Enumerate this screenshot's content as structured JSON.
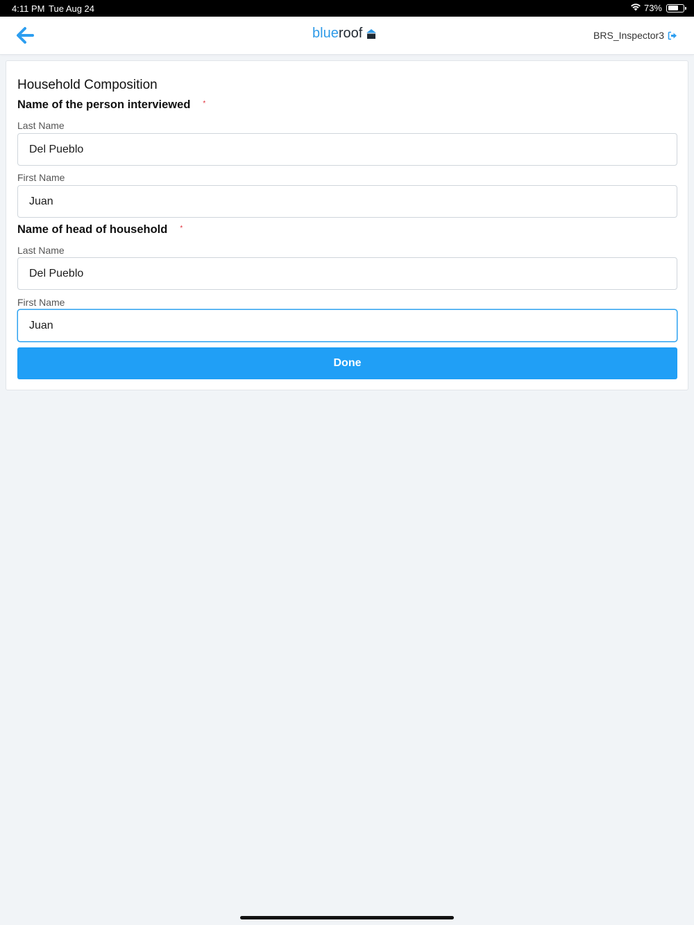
{
  "status_bar": {
    "time": "4:11 PM",
    "date": "Tue Aug 24",
    "battery_text": "73%",
    "battery_level": 0.73,
    "wifi_icon": "wifi-icon"
  },
  "nav": {
    "back_icon": "arrow-left-icon",
    "logo_blue": "blue",
    "logo_dark": "roof",
    "logo_icon": "house-icon",
    "username": "BRS_Inspector3",
    "logout_icon": "logout-icon",
    "accent_color": "#2f9be8"
  },
  "form": {
    "title": "Household Composition",
    "interviewed": {
      "heading": "Name of the person interviewed",
      "required_mark": "*",
      "last_name_label": "Last Name",
      "last_name_value": "Del Pueblo",
      "first_name_label": "First Name",
      "first_name_value": "Juan"
    },
    "head": {
      "heading": "Name of head of household",
      "required_mark": "*",
      "last_name_label": "Last Name",
      "last_name_value": "Del Pueblo",
      "first_name_label": "First Name",
      "first_name_value": "Juan"
    },
    "done_label": "Done",
    "button_color": "#209ff6"
  }
}
